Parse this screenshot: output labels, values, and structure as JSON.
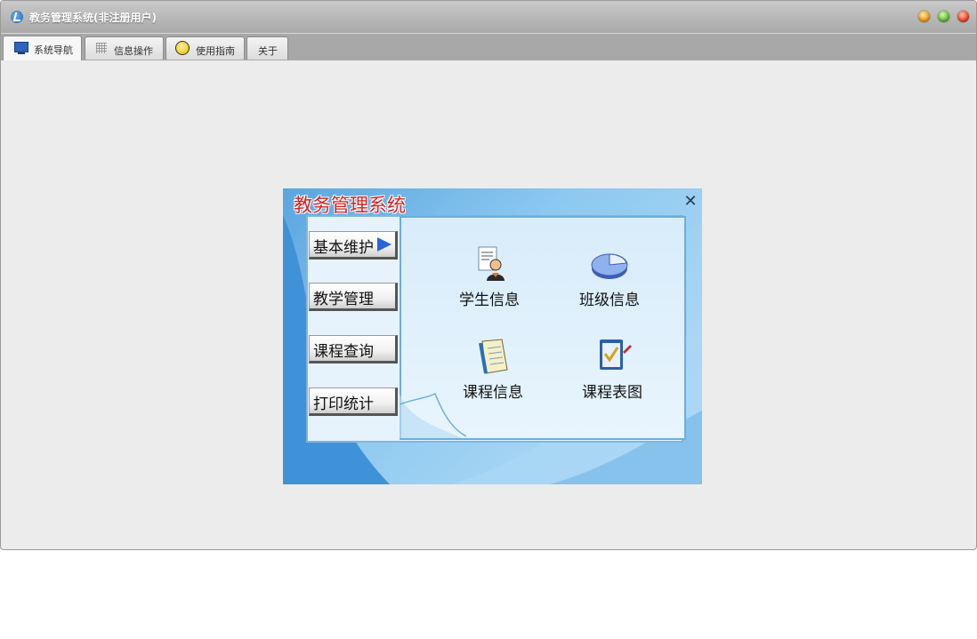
{
  "window": {
    "title": "教务管理系统(非注册用户)"
  },
  "tabs": [
    {
      "label": "系统导航",
      "icon": "monitor-icon"
    },
    {
      "label": "信息操作",
      "icon": "grid-icon"
    },
    {
      "label": "使用指南",
      "icon": "bulb-icon"
    },
    {
      "label": "关于"
    }
  ],
  "dialog": {
    "title": "教务管理系统",
    "nav": [
      "基本维护",
      "教学管理",
      "课程查询",
      "打印统计"
    ],
    "modules": [
      {
        "label": "学生信息",
        "icon": "student-icon"
      },
      {
        "label": "班级信息",
        "icon": "class-pie-icon"
      },
      {
        "label": "课程信息",
        "icon": "notebook-icon"
      },
      {
        "label": "课程表图",
        "icon": "checklist-icon"
      }
    ]
  }
}
